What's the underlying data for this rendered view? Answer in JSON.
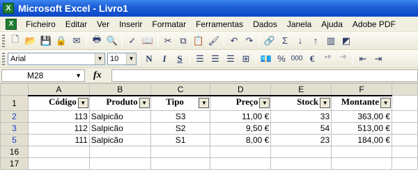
{
  "window": {
    "title": "Microsoft Excel - Livro1",
    "icon": "excel-icon"
  },
  "menu": {
    "items": [
      "Ficheiro",
      "Editar",
      "Ver",
      "Inserir",
      "Formatar",
      "Ferramentas",
      "Dados",
      "Janela",
      "Ajuda",
      "Adobe PDF"
    ]
  },
  "format_toolbar": {
    "font_name": "Arial",
    "font_size": "10",
    "bold": "N",
    "italic": "I",
    "underline": "S",
    "percent": "%",
    "thousands": "000",
    "currency": "€"
  },
  "formula_bar": {
    "name_box": "M28",
    "fx_label": "fx",
    "formula": ""
  },
  "sheet": {
    "columns": [
      "A",
      "B",
      "C",
      "D",
      "E",
      "F"
    ],
    "header_row_label": "1",
    "headers": [
      "Código",
      "Produto",
      "Tipo",
      "Preço",
      "Stock",
      "Montante"
    ],
    "rows": [
      {
        "row": "2",
        "cells": [
          "113",
          "Salpicão",
          "S3",
          "11,00 €",
          "33",
          "363,00 €"
        ]
      },
      {
        "row": "3",
        "cells": [
          "112",
          "Salpicão",
          "S2",
          "9,50 €",
          "54",
          "513,00 €"
        ]
      },
      {
        "row": "5",
        "cells": [
          "111",
          "Salpicão",
          "S1",
          "8,00 €",
          "23",
          "184,00 €"
        ]
      }
    ],
    "empty_rows": [
      "16",
      "17"
    ]
  }
}
